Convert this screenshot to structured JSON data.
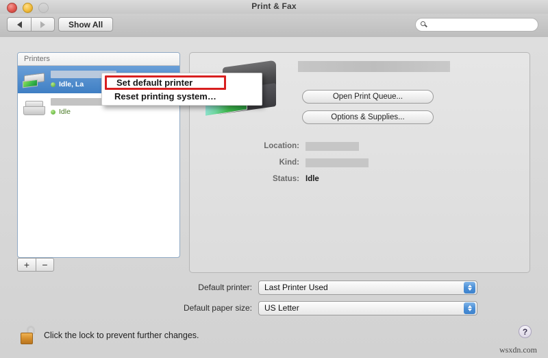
{
  "window": {
    "title": "Print & Fax",
    "traffic_lights": {
      "close": "close-button",
      "minimize": "minimize-button",
      "zoom": "zoom-button-disabled"
    }
  },
  "toolbar": {
    "back_label": "◀",
    "forward_label": "▶",
    "show_all_label": "Show All",
    "search": {
      "value": "",
      "placeholder": ""
    }
  },
  "printer_list": {
    "header": "Printers",
    "items": [
      {
        "name": "",
        "name_redacted": true,
        "status": "Idle, La",
        "selected": true,
        "icon": "inkjet-printer-icon"
      },
      {
        "name": "",
        "name_redacted": true,
        "status": "Idle",
        "selected": false,
        "icon": "laser-printer-icon"
      }
    ],
    "add_label": "+",
    "remove_label": "−"
  },
  "context_menu": {
    "items": [
      {
        "label": "Set default printer",
        "highlighted": true
      },
      {
        "label": "Reset printing system…",
        "highlighted": false
      }
    ],
    "highlight_color": "#d81f1f"
  },
  "detail": {
    "printer_name": "",
    "printer_name_redacted": true,
    "buttons": {
      "open_queue": "Open Print Queue...",
      "options_supplies": "Options & Supplies..."
    },
    "fields": [
      {
        "label": "Location:",
        "value": "",
        "redacted": true
      },
      {
        "label": "Kind:",
        "value": "",
        "redacted": true
      },
      {
        "label": "Status:",
        "value": "Idle",
        "redacted": false
      }
    ]
  },
  "bottom": {
    "default_printer": {
      "label": "Default printer:",
      "value": "Last Printer Used"
    },
    "default_paper_size": {
      "label": "Default paper size:",
      "value": "US Letter"
    }
  },
  "footer": {
    "lock_text": "Click the lock to prevent further changes.",
    "lock_state": "unlocked",
    "help_label": "?",
    "watermark": "wsxdn.com"
  }
}
